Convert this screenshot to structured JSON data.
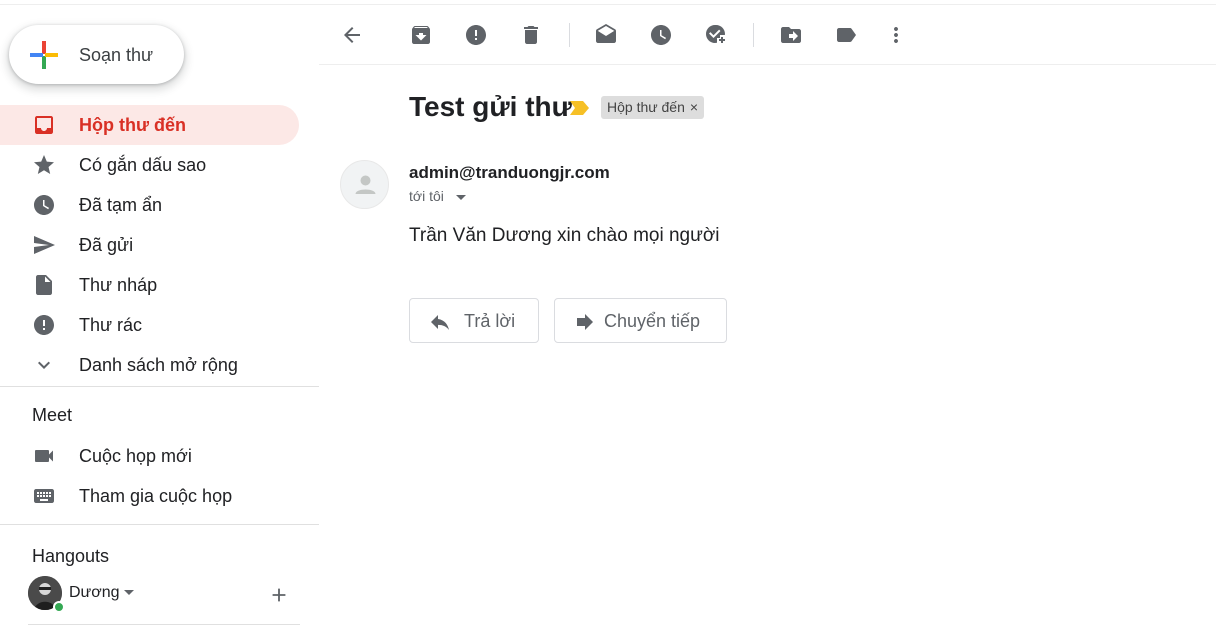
{
  "compose": {
    "label": "Soạn thư"
  },
  "sidebar": {
    "items": [
      {
        "label": "Hộp thư đến",
        "icon": "inbox-icon",
        "active": true
      },
      {
        "label": "Có gắn dấu sao",
        "icon": "star-icon"
      },
      {
        "label": "Đã tạm ẩn",
        "icon": "clock-icon"
      },
      {
        "label": "Đã gửi",
        "icon": "send-icon"
      },
      {
        "label": "Thư nháp",
        "icon": "draft-icon"
      },
      {
        "label": "Thư rác",
        "icon": "spam-icon"
      },
      {
        "label": "Danh sách mở rộng",
        "icon": "chevron-down-icon"
      }
    ]
  },
  "meet": {
    "title": "Meet",
    "items": [
      {
        "label": "Cuộc họp mới",
        "icon": "video-icon"
      },
      {
        "label": "Tham gia cuộc họp",
        "icon": "keyboard-icon"
      }
    ]
  },
  "hangouts": {
    "title": "Hangouts",
    "user_name": "Dương",
    "status_color": "#34a853"
  },
  "message": {
    "subject": "Test gửi thư",
    "label_chip": "Hộp thư đến",
    "label_remove": "×",
    "sender": "admin@tranduongjr.com",
    "recipient": "tới tôi",
    "body": "Trần Văn Dương xin chào mọi người"
  },
  "actions": {
    "reply": "Trả lời",
    "forward": "Chuyển tiếp"
  },
  "colors": {
    "accent_red": "#d93025",
    "active_bg": "#fce8e6",
    "icon_gray": "#5f6368",
    "importance_yellow": "#f6c026"
  }
}
